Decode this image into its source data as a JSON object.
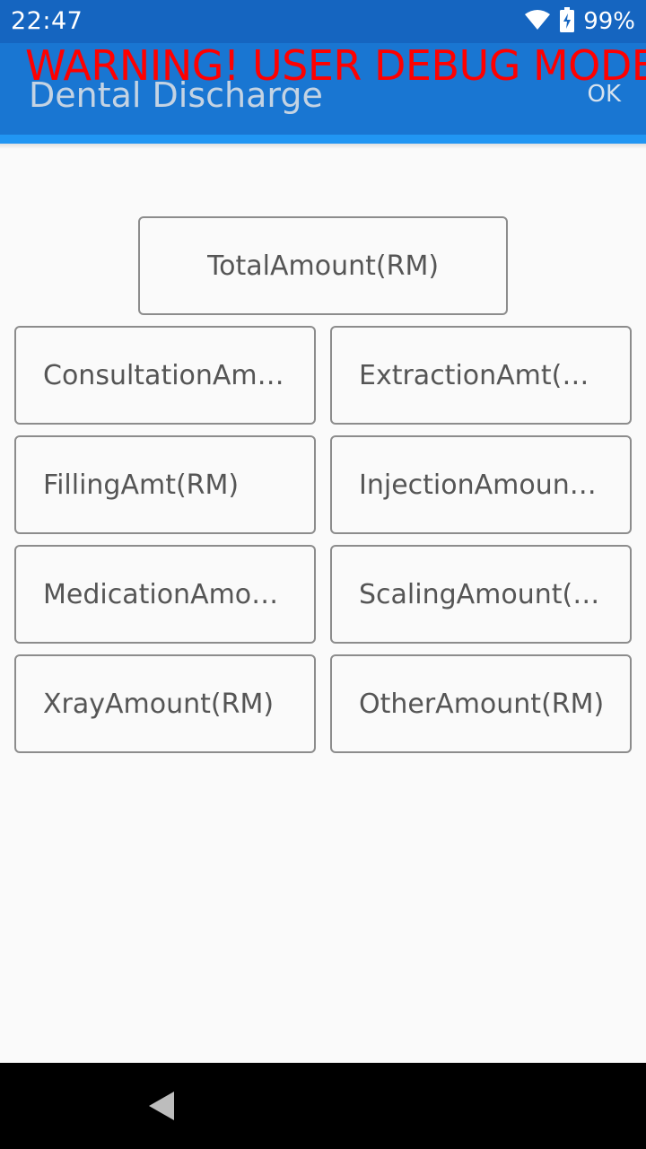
{
  "status_bar": {
    "time": "22:47",
    "battery_percent": "99%",
    "icons": [
      "wifi-icon",
      "battery-icon"
    ]
  },
  "app_bar": {
    "title": "Dental Discharge",
    "ok_label": "OK",
    "debug_warning": "WARNING! USER DEBUG MODE"
  },
  "fields": {
    "total": "TotalAmount(RM)",
    "consultation": "ConsultationAmt(RM)",
    "extraction": "ExtractionAmt(RM)",
    "filling": "FillingAmt(RM)",
    "injection": "InjectionAmount(RM)",
    "medication": "MedicationAmount(RM)",
    "scaling": "ScalingAmount(RM)",
    "xray": "XrayAmount(RM)",
    "other": "OtherAmount(RM)"
  },
  "nav_bar": {
    "icons": [
      "back-icon"
    ]
  },
  "colors": {
    "status_bar": "#1565c0",
    "app_bar": "#1976d2",
    "warning": "#ff0000"
  }
}
